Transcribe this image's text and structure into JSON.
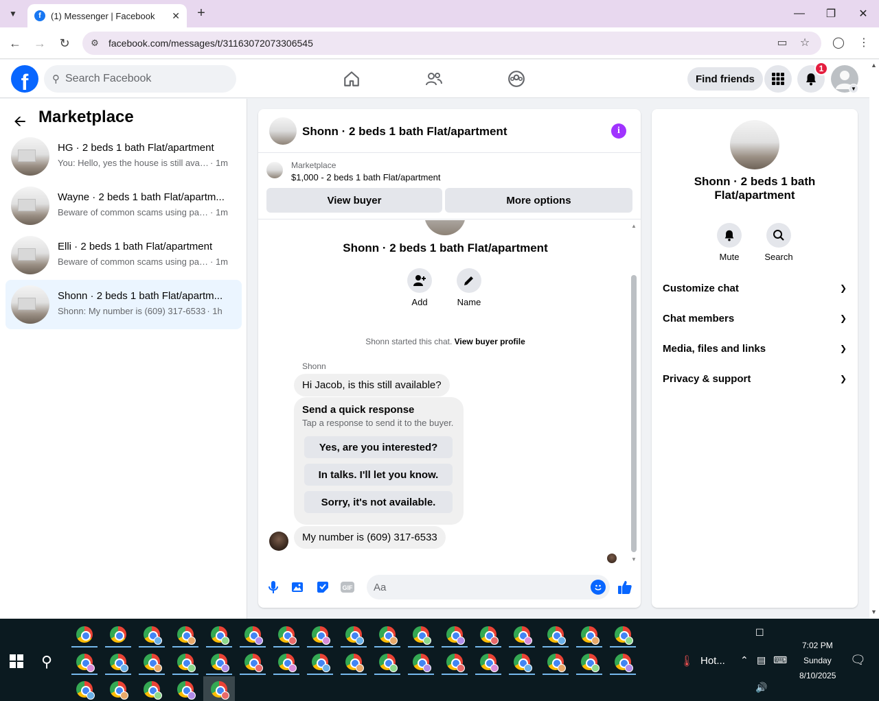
{
  "browser": {
    "tab_title": "(1) Messenger | Facebook",
    "url": "facebook.com/messages/t/31163072073306545"
  },
  "header": {
    "search_placeholder": "Search Facebook",
    "find_friends": "Find friends",
    "notification_count": "1"
  },
  "sidebar": {
    "title": "Marketplace",
    "conversations": [
      {
        "title": "HG · 2 beds 1 bath Flat/apartment",
        "preview": "You: Hello, yes the house is still availa...",
        "time": "· 1m"
      },
      {
        "title": "Wayne · 2 beds 1 bath Flat/apartm...",
        "preview": "Beware of common scams using pay...",
        "time": "· 1m"
      },
      {
        "title": "Elli · 2 beds 1 bath Flat/apartment",
        "preview": "Beware of common scams using pay...",
        "time": "· 1m"
      },
      {
        "title": "Shonn · 2 beds 1 bath Flat/apartm...",
        "preview": "Shonn: My number is (609) 317-6533",
        "time": "· 1h"
      }
    ]
  },
  "chat": {
    "title": "Shonn · 2 beds 1 bath Flat/apartment",
    "marketplace_label": "Marketplace",
    "listing": "$1,000 - 2 beds 1 bath Flat/apartment",
    "view_buyer": "View buyer",
    "more_options": "More options",
    "intro_title": "Shonn · 2 beds 1 bath Flat/apartment",
    "action_add": "Add",
    "action_name": "Name",
    "started_text": "Shonn started this chat.",
    "view_buyer_profile": "View buyer profile",
    "sender_name": "Shonn",
    "message_1": "Hi Jacob, is this still available?",
    "quick_title": "Send a quick response",
    "quick_subtitle": "Tap a response to send it to the buyer.",
    "quick_responses": [
      "Yes, are you interested?",
      "In talks. I'll let you know.",
      "Sorry, it's not available."
    ],
    "message_2": "My number is (609) 317-6533",
    "composer_placeholder": "Aa"
  },
  "right_panel": {
    "title": "Shonn · 2 beds 1 bath Flat/apartment",
    "mute": "Mute",
    "search": "Search",
    "sections": [
      "Customize chat",
      "Chat members",
      "Media, files and links",
      "Privacy & support"
    ]
  },
  "taskbar": {
    "weather": "Hot...",
    "time": "7:02 PM",
    "day": "Sunday",
    "date": "8/10/2025"
  },
  "colors": {
    "fb_blue": "#0866ff",
    "info_purple": "#a033ff",
    "badge_red": "#e41e3f"
  }
}
